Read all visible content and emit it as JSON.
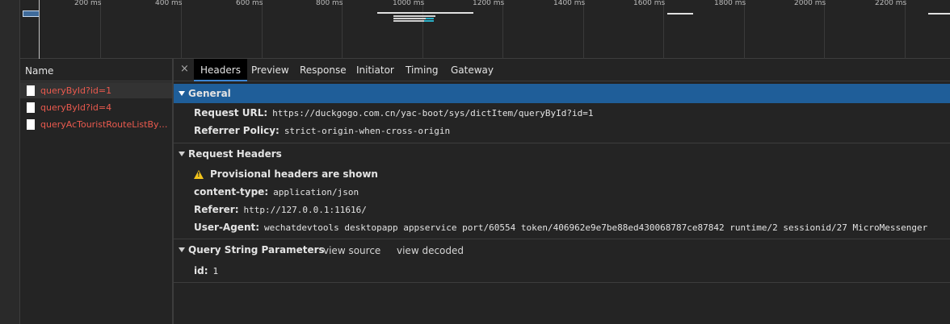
{
  "timeline": {
    "ticks": [
      "200 ms",
      "400 ms",
      "600 ms",
      "800 ms",
      "1000 ms",
      "1200 ms",
      "1400 ms",
      "1600 ms",
      "1800 ms",
      "2000 ms",
      "2200 ms"
    ]
  },
  "network": {
    "name_header": "Name",
    "requests": [
      {
        "name": "queryById?id=1",
        "selected": true
      },
      {
        "name": "queryById?id=4",
        "selected": false
      },
      {
        "name": "queryAcTouristRouteListByS...",
        "selected": false
      }
    ]
  },
  "details": {
    "close_glyph": "×",
    "tabs": [
      "Headers",
      "Preview",
      "Response",
      "Initiator",
      "Timing",
      "Gateway"
    ],
    "active_tab": "Headers",
    "general": {
      "title": "General",
      "request_url_label": "Request URL:",
      "request_url": "https://duckgogo.com.cn/yac-boot/sys/dictItem/queryById?id=1",
      "referrer_policy_label": "Referrer Policy:",
      "referrer_policy": "strict-origin-when-cross-origin"
    },
    "request_headers": {
      "title": "Request Headers",
      "warning": "Provisional headers are shown",
      "content_type_label": "content-type:",
      "content_type": "application/json",
      "referer_label": "Referer:",
      "referer": "http://127.0.0.1:11616/",
      "user_agent_label": "User-Agent:",
      "user_agent": "wechatdevtools desktopapp appservice port/60554 token/406962e9e7be88ed430068787ce87842 runtime/2 sessionid/27 MicroMessenger"
    },
    "query_string": {
      "title": "Query String Parameters",
      "view_source": "view source",
      "view_decoded": "view decoded",
      "id_label": "id:",
      "id_value": "1"
    }
  },
  "colors": {
    "accent_blue": "#1f5e99",
    "request_name_red": "#ea5a4e",
    "warning_yellow": "#f2c31b"
  }
}
